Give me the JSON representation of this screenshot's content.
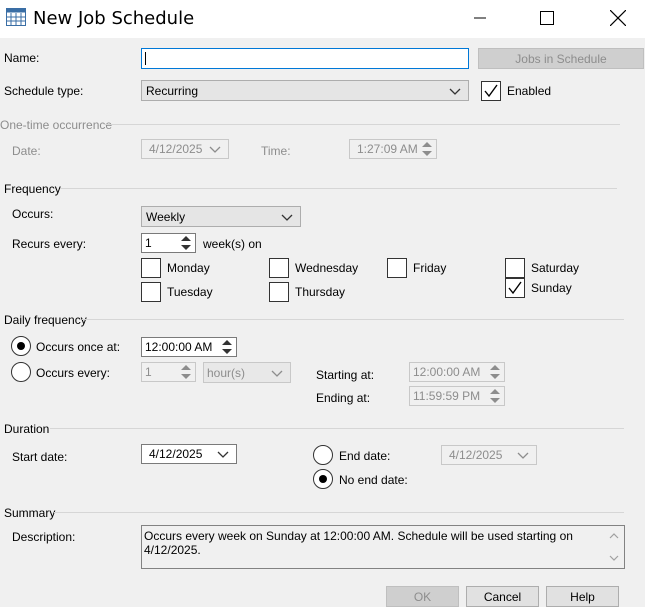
{
  "window": {
    "title": "New Job Schedule"
  },
  "name_field": {
    "label": "Name:",
    "value": ""
  },
  "jobs_in_schedule_button": "Jobs in Schedule",
  "schedule_type": {
    "label": "Schedule type:",
    "value": "Recurring"
  },
  "enabled": {
    "label": "Enabled",
    "checked": true
  },
  "one_time": {
    "group_label": "One-time occurrence",
    "date_label": "Date:",
    "date_value": "4/12/2025",
    "time_label": "Time:",
    "time_value": "1:27:09 AM"
  },
  "frequency": {
    "group_label": "Frequency",
    "occurs_label": "Occurs:",
    "occurs_value": "Weekly",
    "recurs_label": "Recurs every:",
    "recurs_value": "1",
    "recurs_unit": "week(s) on",
    "days": {
      "monday": {
        "label": "Monday",
        "checked": false
      },
      "tuesday": {
        "label": "Tuesday",
        "checked": false
      },
      "wednesday": {
        "label": "Wednesday",
        "checked": false
      },
      "thursday": {
        "label": "Thursday",
        "checked": false
      },
      "friday": {
        "label": "Friday",
        "checked": false
      },
      "saturday": {
        "label": "Saturday",
        "checked": false
      },
      "sunday": {
        "label": "Sunday",
        "checked": true
      }
    }
  },
  "daily_frequency": {
    "group_label": "Daily frequency",
    "once_label": "Occurs once at:",
    "once_value": "12:00:00 AM",
    "every_label": "Occurs every:",
    "every_value": "1",
    "every_unit": "hour(s)",
    "starting_label": "Starting at:",
    "starting_value": "12:00:00 AM",
    "ending_label": "Ending at:",
    "ending_value": "11:59:59 PM",
    "selected": "once"
  },
  "duration": {
    "group_label": "Duration",
    "start_label": "Start date:",
    "start_value": "4/12/2025",
    "end_label": "End date:",
    "end_value": "4/12/2025",
    "no_end_label": "No end date:",
    "selected": "no_end"
  },
  "summary": {
    "group_label": "Summary",
    "description_label": "Description:",
    "description_text": "Occurs every week on Sunday at 12:00:00 AM. Schedule will be used starting on 4/12/2025."
  },
  "buttons": {
    "ok": "OK",
    "cancel": "Cancel",
    "help": "Help"
  }
}
